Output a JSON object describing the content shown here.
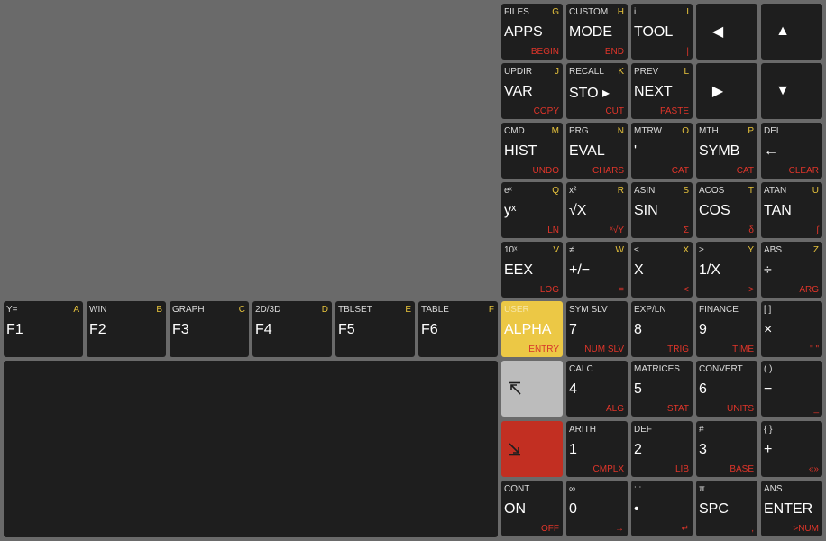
{
  "fkeys": [
    {
      "shift": "Y=",
      "alpha": "A",
      "main": "F1"
    },
    {
      "shift": "WIN",
      "alpha": "B",
      "main": "F2"
    },
    {
      "shift": "GRAPH",
      "alpha": "C",
      "main": "F3"
    },
    {
      "shift": "2D/3D",
      "alpha": "D",
      "main": "F4"
    },
    {
      "shift": "TBLSET",
      "alpha": "E",
      "main": "F5"
    },
    {
      "shift": "TABLE",
      "alpha": "F",
      "main": "F6"
    }
  ],
  "keys": {
    "apps": {
      "shift": "FILES",
      "alpha": "G",
      "main": "APPS",
      "right": "BEGIN"
    },
    "mode": {
      "shift": "CUSTOM",
      "alpha": "H",
      "main": "MODE",
      "right": "END"
    },
    "tool": {
      "shift": "i",
      "alpha": "I",
      "main": "TOOL",
      "right": "|"
    },
    "left": {
      "main": "◀"
    },
    "up": {
      "main": "▲"
    },
    "var": {
      "shift": "UPDIR",
      "alpha": "J",
      "main": "VAR",
      "right": "COPY"
    },
    "sto": {
      "shift": "RECALL",
      "alpha": "K",
      "main": "STO ▸",
      "right": "CUT"
    },
    "next": {
      "shift": "PREV",
      "alpha": "L",
      "main": "NEXT",
      "right": "PASTE"
    },
    "right": {
      "main": "▶"
    },
    "down": {
      "main": "▼"
    },
    "hist": {
      "shift": "CMD",
      "alpha": "M",
      "main": "HIST",
      "right": "UNDO"
    },
    "eval": {
      "shift": "PRG",
      "alpha": "N",
      "main": "EVAL",
      "right": "CHARS"
    },
    "tick": {
      "shift": "MTRW",
      "alpha": "O",
      "main": "'",
      "right": "CAT"
    },
    "symb": {
      "shift": "MTH",
      "alpha": "P",
      "main": "SYMB",
      "right": "CAT"
    },
    "del": {
      "shift": "DEL",
      "alpha": "",
      "main": "←",
      "right": "CLEAR"
    },
    "yx": {
      "shift": "eˣ",
      "alpha": "Q",
      "main": "yˣ",
      "right": "LN"
    },
    "sqrt": {
      "shift": "x²",
      "alpha": "R",
      "main": "√X",
      "right": "ˣ√Y"
    },
    "sin": {
      "shift": "ASIN",
      "alpha": "S",
      "main": "SIN",
      "right": "Σ"
    },
    "cos": {
      "shift": "ACOS",
      "alpha": "T",
      "main": "COS",
      "right": "δ"
    },
    "tan": {
      "shift": "ATAN",
      "alpha": "U",
      "main": "TAN",
      "right": "∫"
    },
    "eex": {
      "shift": "10ˣ",
      "alpha": "V",
      "main": "EEX",
      "right": "LOG"
    },
    "neg": {
      "shift": "≠",
      "alpha": "W",
      "main": "+/−",
      "right": "="
    },
    "x": {
      "shift": "≤",
      "alpha": "X",
      "main": "X",
      "right": "<"
    },
    "inv": {
      "shift": "≥",
      "alpha": "Y",
      "main": "1/X",
      "right": ">"
    },
    "div": {
      "shift": "ABS",
      "alpha": "Z",
      "main": "÷",
      "right": "ARG"
    },
    "alphakey": {
      "shift": "USER",
      "alpha": "",
      "main": "ALPHA",
      "right": "ENTRY"
    },
    "k7": {
      "shift": "SYM SLV",
      "alpha": "",
      "main": "7",
      "right": "NUM SLV"
    },
    "k8": {
      "shift": "EXP/LN",
      "alpha": "",
      "main": "8",
      "right": "TRIG"
    },
    "k9": {
      "shift": "FINANCE",
      "alpha": "",
      "main": "9",
      "right": "TIME"
    },
    "mul": {
      "shift": "[ ]",
      "alpha": "",
      "main": "×",
      "right": "\" \""
    },
    "k4": {
      "shift": "CALC",
      "alpha": "",
      "main": "4",
      "right": "ALG"
    },
    "k5": {
      "shift": "MATRICES",
      "alpha": "",
      "main": "5",
      "right": "STAT"
    },
    "k6": {
      "shift": "CONVERT",
      "alpha": "",
      "main": "6",
      "right": "UNITS"
    },
    "sub": {
      "shift": "( )",
      "alpha": "",
      "main": "−",
      "right": "_"
    },
    "k1": {
      "shift": "ARITH",
      "alpha": "",
      "main": "1",
      "right": "CMPLX"
    },
    "k2": {
      "shift": "DEF",
      "alpha": "",
      "main": "2",
      "right": "LIB"
    },
    "k3": {
      "shift": "#",
      "alpha": "",
      "main": "3",
      "right": "BASE"
    },
    "add": {
      "shift": "{ }",
      "alpha": "",
      "main": "+",
      "right": "«»"
    },
    "on": {
      "shift": "CONT",
      "alpha": "",
      "main": "ON",
      "right": "OFF"
    },
    "k0": {
      "shift": "∞",
      "alpha": "",
      "main": "0",
      "right": "→"
    },
    "dot": {
      "shift": ": :",
      "alpha": "",
      "main": "•",
      "right": "↵"
    },
    "spc": {
      "shift": "π",
      "alpha": "",
      "main": "SPC",
      "right": ","
    },
    "enter": {
      "shift": "ANS",
      "alpha": "",
      "main": "ENTER",
      "right": ">NUM"
    }
  },
  "shift_keys": {
    "left": "⇱",
    "right": "⇲"
  },
  "colors": {
    "background": "#6a6a6a",
    "key": "#1e1e1e",
    "alpha": "#ecc845",
    "left_shift": "#bcbcbc",
    "right_shift": "#c22f22",
    "shift_label": "#e0352a",
    "alpha_label": "#e8c43c"
  }
}
